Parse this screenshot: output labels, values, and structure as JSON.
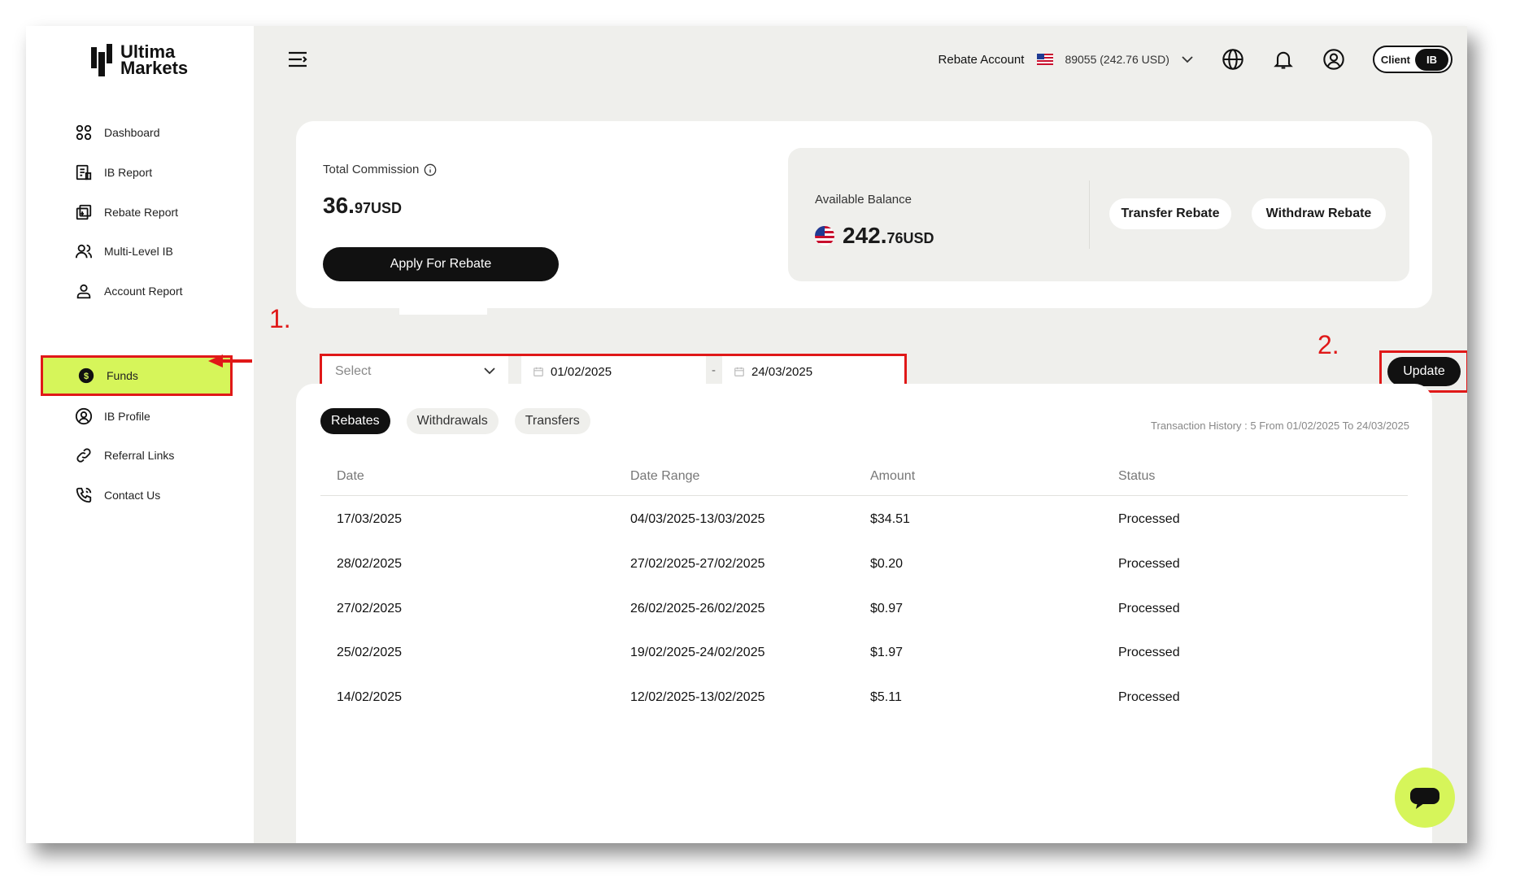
{
  "brand": {
    "line1": "Ultima",
    "line2": "Markets"
  },
  "sidebar": {
    "items": [
      {
        "label": "Dashboard",
        "icon": "dashboard-icon"
      },
      {
        "label": "IB Report",
        "icon": "report-icon"
      },
      {
        "label": "Rebate Report",
        "icon": "rebate-report-icon"
      },
      {
        "label": "Multi-Level IB",
        "icon": "users-icon"
      },
      {
        "label": "Account Report",
        "icon": "user-icon"
      },
      {
        "label": "Funds",
        "icon": "funds-icon",
        "active": true
      },
      {
        "label": "IB Profile",
        "icon": "profile-icon"
      },
      {
        "label": "Referral Links",
        "icon": "link-icon"
      },
      {
        "label": "Contact Us",
        "icon": "phone-icon"
      }
    ]
  },
  "header": {
    "account_label": "Rebate Account",
    "account_value": "89055 (242.76 USD)",
    "toggle": {
      "left": "Client",
      "right": "IB"
    }
  },
  "summary": {
    "total_commission_label": "Total Commission",
    "total_commission_int": "36.",
    "total_commission_dec": "97USD",
    "apply_button": "Apply For Rebate",
    "available_balance_label": "Available Balance",
    "available_balance_int": "242.",
    "available_balance_dec": "76USD",
    "transfer_button": "Transfer Rebate",
    "withdraw_button": "Withdraw Rebate"
  },
  "filters": {
    "select_placeholder": "Select",
    "date_from": "01/02/2025",
    "date_sep": "-",
    "date_to": "24/03/2025",
    "update_button": "Update",
    "step1": "1.",
    "step2": "2."
  },
  "history": {
    "tabs": [
      "Rebates",
      "Withdrawals",
      "Transfers"
    ],
    "active_tab": "Rebates",
    "summary": "Transaction History : 5   From 01/02/2025 To 24/03/2025",
    "columns": [
      "Date",
      "Date Range",
      "Amount",
      "Status"
    ],
    "rows": [
      [
        "17/03/2025",
        "04/03/2025-13/03/2025",
        "$34.51",
        "Processed"
      ],
      [
        "28/02/2025",
        "27/02/2025-27/02/2025",
        "$0.20",
        "Processed"
      ],
      [
        "27/02/2025",
        "26/02/2025-26/02/2025",
        "$0.97",
        "Processed"
      ],
      [
        "25/02/2025",
        "19/02/2025-24/02/2025",
        "$1.97",
        "Processed"
      ],
      [
        "14/02/2025",
        "12/02/2025-13/02/2025",
        "$5.11",
        "Processed"
      ]
    ]
  },
  "colors": {
    "accent": "#d6f55a",
    "dark": "#111111",
    "highlight": "#e01818",
    "bg": "#efefec"
  }
}
